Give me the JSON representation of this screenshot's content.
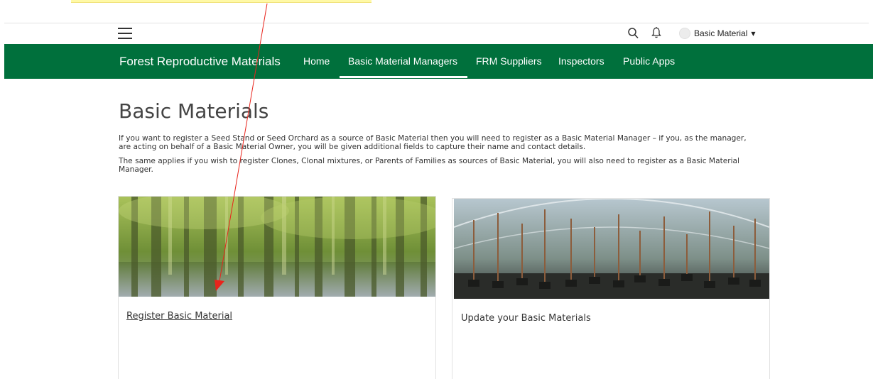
{
  "header": {
    "user_name": "Basic Material",
    "icons": [
      "hamburger-icon",
      "search-icon",
      "bell-icon",
      "caret-down-icon"
    ]
  },
  "nav": {
    "brand": "Forest Reproductive Materials",
    "items": [
      {
        "label": "Home",
        "active": false
      },
      {
        "label": "Basic Material Managers",
        "active": true
      },
      {
        "label": "FRM Suppliers",
        "active": false
      },
      {
        "label": "Inspectors",
        "active": false
      },
      {
        "label": "Public Apps",
        "active": false
      }
    ],
    "color": "#00703c"
  },
  "main": {
    "title": "Basic Materials",
    "paragraphs": [
      "If you want to register a Seed Stand or Seed Orchard as a source of Basic Material then you will need to register as a Basic Material Manager – if you, as the manager, are acting on behalf of a Basic Material Owner, you will be given additional fields to capture their name and contact details.",
      "The same applies if you wish to register Clones, Clonal mixtures, or Parents of Families as sources of Basic Material, you will also need to register as a Basic Material Manager."
    ],
    "cards": [
      {
        "label": "Register Basic Material",
        "image": "forest-image"
      },
      {
        "label": "Update your Basic Materials",
        "image": "polytunnel-trees-image"
      }
    ]
  },
  "annotation": {
    "color": "#e8241c",
    "highlight_color": "#fff9a6"
  }
}
